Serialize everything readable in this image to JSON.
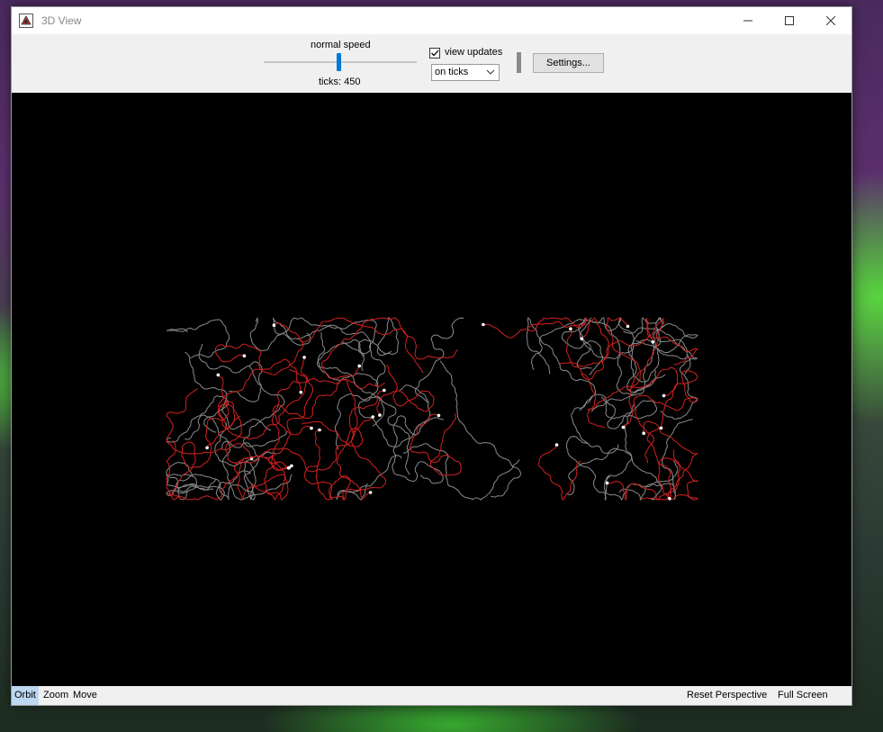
{
  "window": {
    "title": "3D View",
    "controls": [
      "minimize",
      "maximize",
      "close"
    ]
  },
  "toolbar": {
    "speed_label": "normal speed",
    "speed_value": 0.5,
    "ticks_label": "ticks: 450",
    "view_updates_label": "view updates",
    "view_updates_checked": true,
    "update_mode_value": "on ticks",
    "settings_label": "Settings..."
  },
  "canvas": {
    "background": "#000000",
    "trail_colors": {
      "red": "#d42020",
      "gray": "#8a8a8a",
      "agent": "#ffffff"
    }
  },
  "statusbar": {
    "modes": [
      "Orbit",
      "Zoom",
      "Move"
    ],
    "active_mode": "Orbit",
    "reset_label": "Reset Perspective",
    "fullscreen_label": "Full Screen"
  },
  "colors": {
    "accent": "#0078d7",
    "active_mode_bg": "#bcd7f0"
  }
}
